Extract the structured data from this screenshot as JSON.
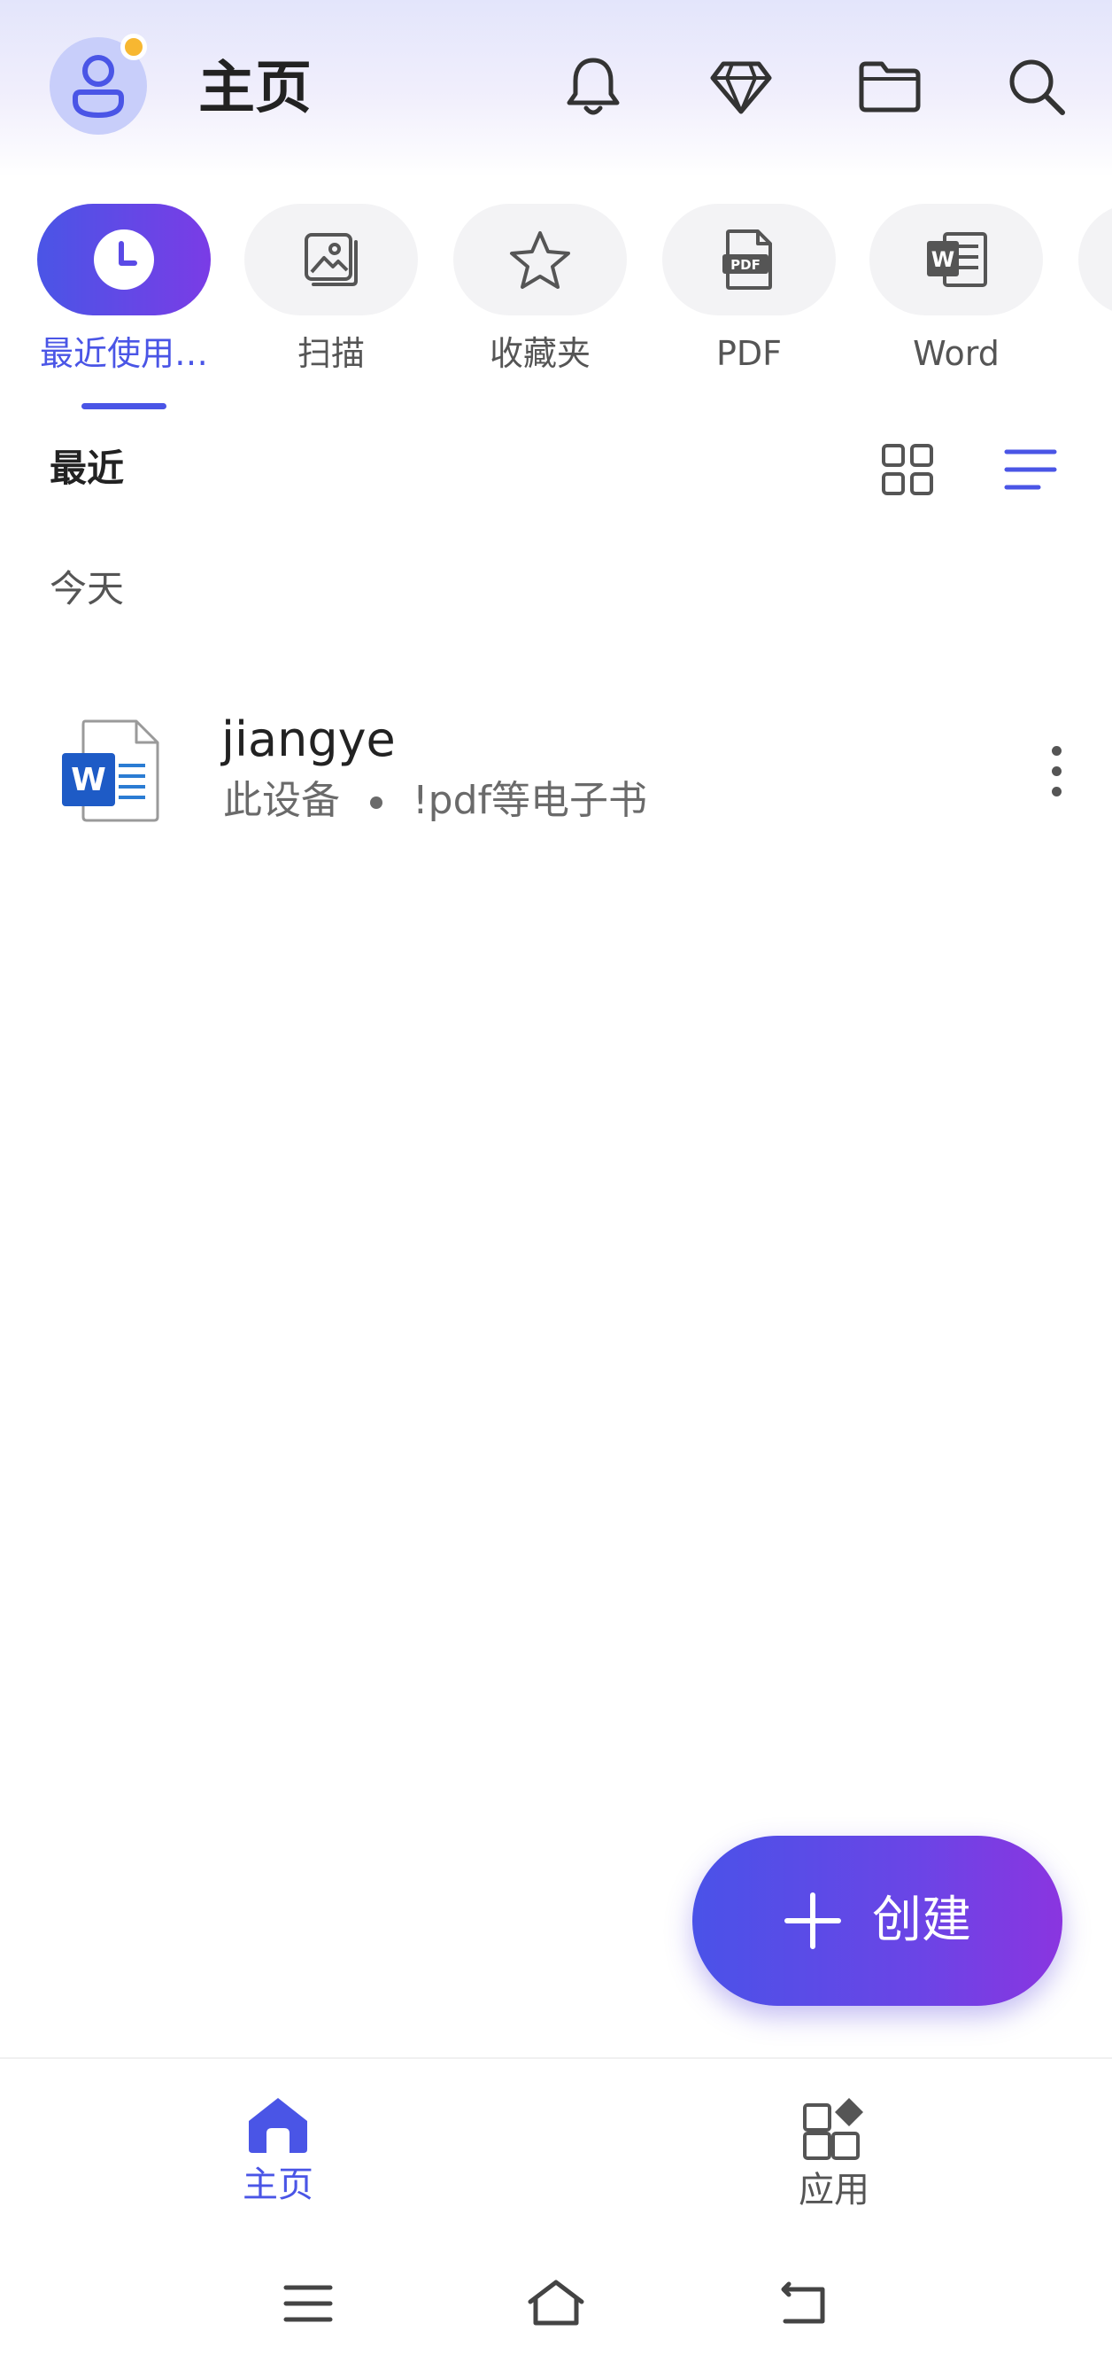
{
  "header": {
    "title": "主页",
    "avatar_icon": "user-icon",
    "notification_dot_color": "#f7b731",
    "icons": [
      "bell-icon",
      "diamond-icon",
      "folder-icon",
      "search-icon"
    ]
  },
  "categories": [
    {
      "label": "最近使用…",
      "icon": "clock-icon",
      "active": true
    },
    {
      "label": "扫描",
      "icon": "image-scan-icon",
      "active": false
    },
    {
      "label": "收藏夹",
      "icon": "star-icon",
      "active": false
    },
    {
      "label": "PDF",
      "icon": "pdf-file-icon",
      "active": false
    },
    {
      "label": "Word",
      "icon": "word-file-icon",
      "active": false
    }
  ],
  "section": {
    "title": "最近",
    "views": [
      "grid-view-icon",
      "list-view-icon"
    ],
    "active_view": "list"
  },
  "groups": [
    {
      "label": "今天",
      "files": [
        {
          "name": "jiangye",
          "location": "此设备",
          "folder": "!pdf等电子书",
          "type_icon": "word-doc-icon"
        }
      ]
    }
  ],
  "fab": {
    "label": "创建",
    "icon": "plus-icon"
  },
  "bottom_nav": [
    {
      "label": "主页",
      "icon": "home-icon",
      "active": true
    },
    {
      "label": "应用",
      "icon": "apps-icon",
      "active": false
    }
  ],
  "system_nav": [
    "menu-icon",
    "home-outline-icon",
    "back-icon"
  ],
  "colors": {
    "accent": "#4a55e6",
    "accent_end": "#8a35e0",
    "text_primary": "#222222",
    "text_secondary": "#6a6a6a"
  }
}
